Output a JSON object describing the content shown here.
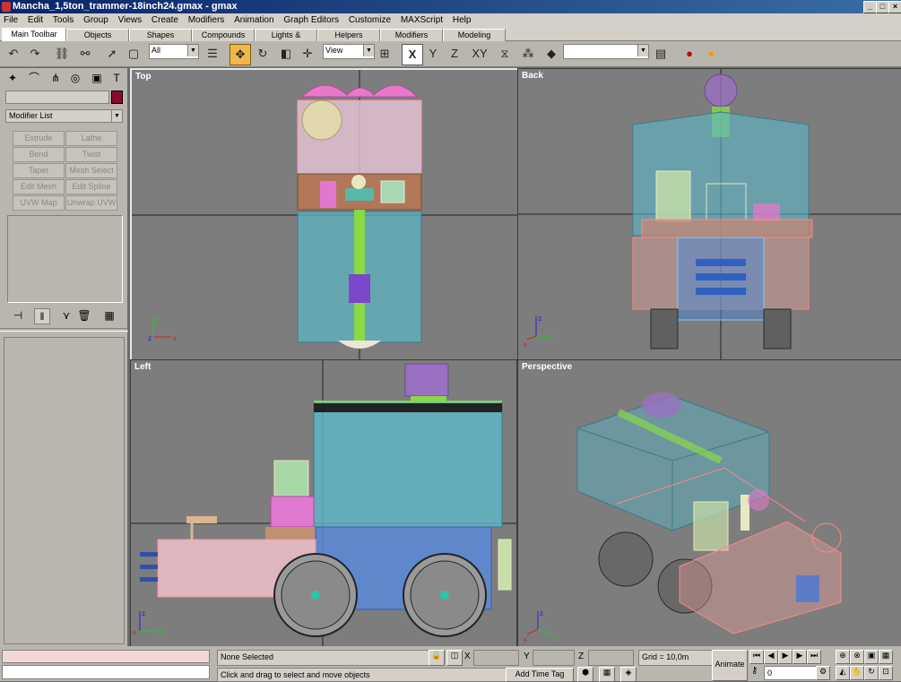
{
  "window": {
    "title": "Mancha_1,5ton_trammer-18inch24.gmax - gmax"
  },
  "menu": [
    "File",
    "Edit",
    "Tools",
    "Group",
    "Views",
    "Create",
    "Modifiers",
    "Animation",
    "Graph Editors",
    "Customize",
    "MAXScript",
    "Help"
  ],
  "tabs": [
    "Main Toolbar",
    "Objects",
    "Shapes",
    "Compounds",
    "Lights & Cameras",
    "Helpers",
    "Modifiers",
    "Modeling"
  ],
  "toolbar": {
    "selection_filter": "All",
    "ref_coord": "View",
    "named_selection": "",
    "axis_x": "X",
    "axis_y": "Y",
    "axis_z": "Z",
    "axis_xy": "XY"
  },
  "command_panel": {
    "modifier_list": "Modifier List",
    "buttons": [
      "Extrude",
      "Lathe",
      "Bend",
      "Twist",
      "Taper",
      "Mesh Select",
      "Edit Mesh",
      "Edit Spline",
      "UVW Map",
      "Unwrap UVW"
    ]
  },
  "viewports": {
    "top": "Top",
    "back": "Back",
    "left": "Left",
    "perspective": "Perspective"
  },
  "axes": {
    "x": "x",
    "y": "y",
    "z": "z"
  },
  "status": {
    "selection": "None Selected",
    "prompt": "Click and drag to select and move objects",
    "add_time_tag": "Add Time Tag",
    "x_label": "X",
    "y_label": "Y",
    "z_label": "Z",
    "grid": "Grid = 10,0m",
    "animate": "Animate",
    "frame": "0"
  },
  "colors": {
    "active_tool": "#f0b84a",
    "title_bar": "#0a246a",
    "viewport_bg": "#7d7d7d",
    "swatch": "#8b0a2a"
  }
}
